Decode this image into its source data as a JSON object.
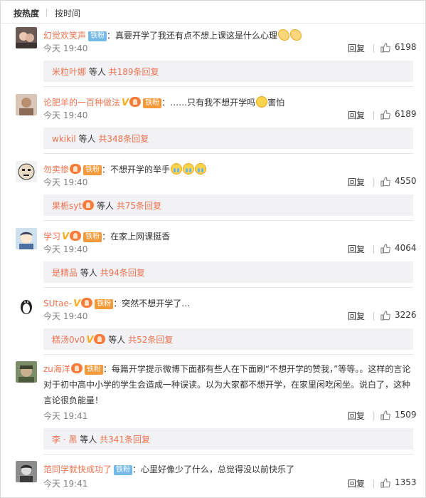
{
  "sort": {
    "hot": "按热度",
    "time": "按时间"
  },
  "ui": {
    "like_icon": "thumbs-up-icon",
    "accent": "#eb7350",
    "link": "#eb7350",
    "badge_blue": "#74b8e6"
  },
  "comments": [
    {
      "user": "幻觉欢笑声",
      "badge": "铁粉",
      "text": "：真要开学了我还有点不想上课这是什么心理",
      "time": "今天 19:40",
      "reply": "回复",
      "likes": "6198",
      "sub": {
        "user": "米粒叶娜",
        "mid": " 等人 ",
        "count": "共189条回复"
      }
    },
    {
      "user": "论肥羊的一百种做法",
      "badge": "铁粉",
      "text": "：……只有我不想开学吗",
      "text2": "害怕",
      "time": "今天 19:40",
      "reply": "回复",
      "likes": "6189",
      "sub": {
        "user": "wkikil",
        "mid": " 等人 ",
        "count": "共348条回复"
      }
    },
    {
      "user": "勿卖惨",
      "badge": "铁粉",
      "text": "：不想开学的举手",
      "time": "今天 19:40",
      "reply": "回复",
      "likes": "4550",
      "sub": {
        "user": "果栀syt",
        "mid": " 等人 ",
        "count": "共75条回复"
      }
    },
    {
      "user": "学习",
      "badge": "铁粉",
      "text": "：在家上网课挺香",
      "time": "今天 19:40",
      "reply": "回复",
      "likes": "4064",
      "sub": {
        "user": "是精品",
        "mid": " 等人 ",
        "count": "共94条回复"
      }
    },
    {
      "user": "SUtae-",
      "badge": "铁粉",
      "text": "：突然不想开学了…",
      "time": "今天 19:40",
      "reply": "回复",
      "likes": "3226",
      "sub": {
        "user": "糕汤0v0",
        "mid": " 等人 ",
        "count": "共52条回复"
      }
    },
    {
      "user": "zu海洋",
      "badge": "铁粉",
      "text": "：每篇开学提示微博下面都有些人在下面刷“不想开学的赞我，”等等。。这样的言论对于初中高中小学的学生会造成一种误读。以为大家都不想开学，在家里闲吃闲坐。说白了，这种言论很负能量！",
      "time": "今天 19:41",
      "reply": "回复",
      "likes": "1509",
      "sub": {
        "user": "李 · 黑",
        "mid": " 等人 ",
        "count": "共341条回复"
      }
    },
    {
      "user": "范同学就快成功了",
      "badge": "铁粉",
      "text": "：心里好像少了什么，总觉得没以前快乐了",
      "time": "今天 19:41",
      "reply": "回复",
      "likes": "1353"
    }
  ]
}
